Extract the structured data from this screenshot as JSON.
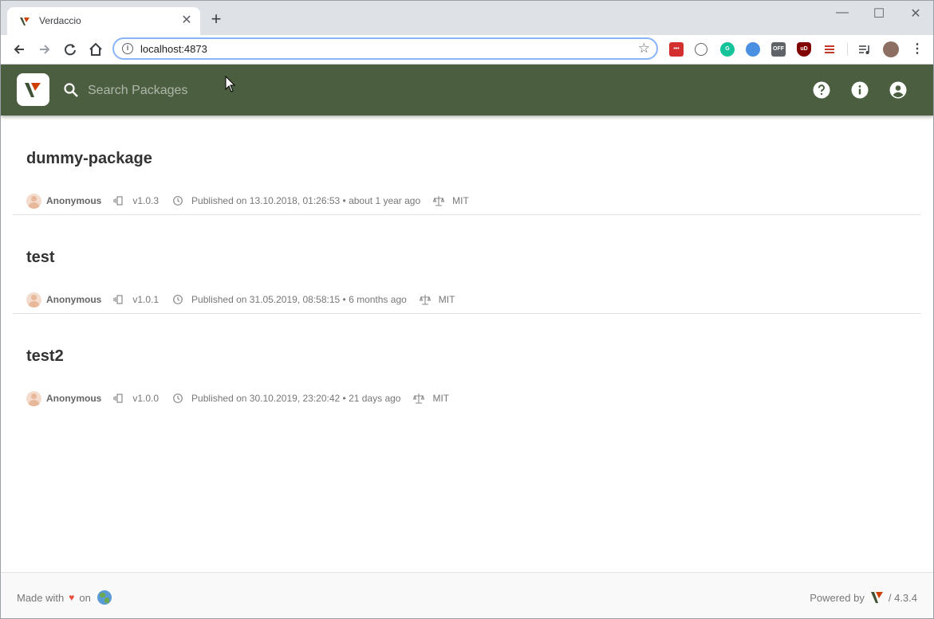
{
  "browser": {
    "tab_title": "Verdaccio",
    "tab_close": "✕",
    "new_tab": "+",
    "url": "localhost:4873",
    "window_controls": {
      "minimize": "—",
      "maximize": "☐",
      "close": "✕"
    },
    "extension_labels": {
      "off": "OFF",
      "ublock": "uD"
    }
  },
  "header": {
    "search_placeholder": "Search Packages",
    "accent_color": "#4b5e40"
  },
  "packages": [
    {
      "name": "dummy-package",
      "author": "Anonymous",
      "version": "v1.0.3",
      "published": "Published on 13.10.2018, 01:26:53 • about 1 year ago",
      "license": "MIT"
    },
    {
      "name": "test",
      "author": "Anonymous",
      "version": "v1.0.1",
      "published": "Published on 31.05.2019, 08:58:15 • 6 months ago",
      "license": "MIT"
    },
    {
      "name": "test2",
      "author": "Anonymous",
      "version": "v1.0.0",
      "published": "Published on 30.10.2019, 23:20:42 • 21 days ago",
      "license": "MIT"
    }
  ],
  "footer": {
    "made_with": "Made with",
    "heart": "♥",
    "on": "on",
    "powered_by": "Powered by",
    "version": "/ 4.3.4"
  }
}
